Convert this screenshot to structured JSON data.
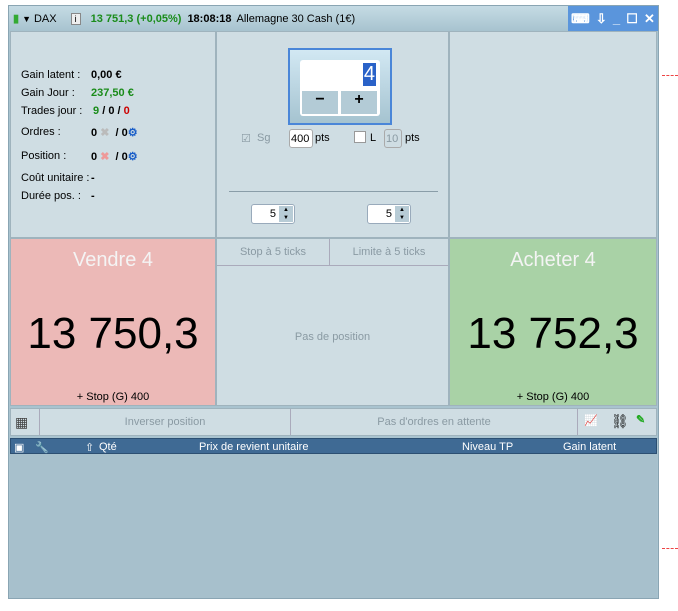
{
  "title": {
    "symbol": "DAX",
    "price": "13 751,3 (+0,05%)",
    "time": "18:08:18",
    "name": "Allemagne 30 Cash (1€)"
  },
  "stats": {
    "gain_latent_label": "Gain latent :",
    "gain_latent": "0,00 €",
    "gain_jour_label": "Gain Jour :",
    "gain_jour": "237,50 €",
    "trades_label": "Trades jour :",
    "trades_a": "9",
    "trades_b": "0",
    "trades_c": "0",
    "sep": "/",
    "ordres_label": "Ordres :",
    "ordres_a": "0",
    "ordres_b": "0",
    "position_label": "Position :",
    "position_a": "0",
    "position_b": "0",
    "cout_label": "Coût unitaire :",
    "cout": "-",
    "duree_label": "Durée pos. :",
    "duree": "-"
  },
  "qty": {
    "value": "4",
    "minus": "−",
    "plus": "+"
  },
  "stops": {
    "sg_label": "Sg",
    "sg_value": "400",
    "pts": "pts",
    "l_label": "L",
    "l_value": "10",
    "spin_left": "5",
    "spin_right": "5"
  },
  "sell": {
    "title": "Vendre 4",
    "price": "13 750,3",
    "stop": "+ Stop (G) 400"
  },
  "buy": {
    "title": "Acheter 4",
    "price": "13 752,3",
    "stop": "+ Stop (G) 400"
  },
  "middle": {
    "stop_ticks": "Stop à 5 ticks",
    "limit_ticks": "Limite à 5 ticks",
    "no_position": "Pas de position"
  },
  "toolbar": {
    "reverse": "Inverser position",
    "no_orders": "Pas d'ordres en attente"
  },
  "table": {
    "columns": [
      "Qté",
      "Prix de revient unitaire",
      "Niveau TP",
      "Gain latent"
    ]
  },
  "colors": {
    "sell_bg": "#ecb9b7",
    "buy_bg": "#a9d2a6",
    "header_bg": "#3f6a94"
  }
}
